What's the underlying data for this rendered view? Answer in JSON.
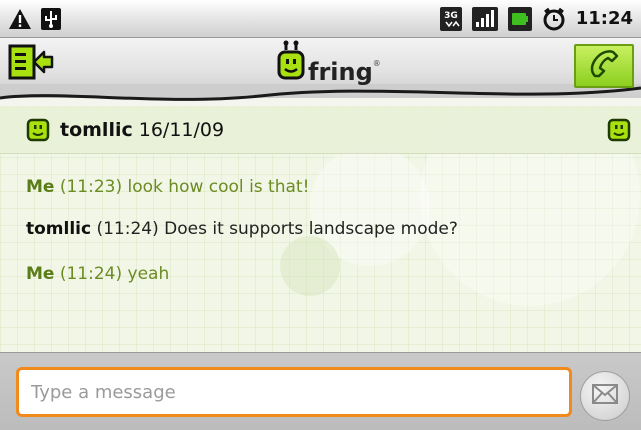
{
  "status_bar": {
    "time": "11:24",
    "network": "3G",
    "icons": [
      "warning-icon",
      "usb-icon",
      "network-3g-icon",
      "signal-icon",
      "battery-icon",
      "alarm-icon"
    ]
  },
  "header": {
    "brand": "fring",
    "brand_mark": "®",
    "icons": [
      "exit-icon",
      "fring-logo-icon",
      "phone-icon"
    ],
    "accent_color": "#8ccf1f"
  },
  "conversation": {
    "contact_name": "tomllic",
    "date": "16/11/09",
    "messages": [
      {
        "sender": "Me",
        "time": "(11:23)",
        "text": "look how cool is that!",
        "from_me": true
      },
      {
        "sender": "tomllic",
        "time": "(11:24)",
        "text": "Does it supports landscape mode?",
        "from_me": false
      },
      {
        "sender": "Me",
        "time": "(11:24)",
        "text": "yeah",
        "from_me": true
      }
    ]
  },
  "compose": {
    "placeholder": "Type a message",
    "value": "",
    "send_icon": "envelope-icon",
    "border_color": "#f08a1a"
  }
}
